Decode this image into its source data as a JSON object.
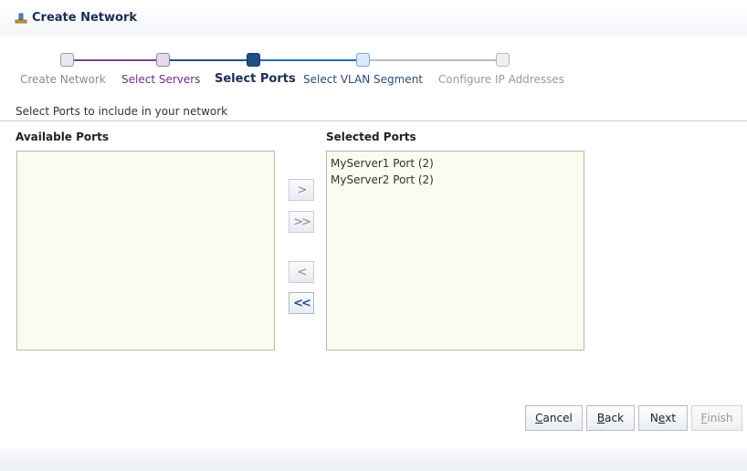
{
  "header": {
    "title": "Create Network",
    "icon": "network-icon"
  },
  "train": {
    "stops": [
      {
        "label": "Create Network",
        "state": "visited"
      },
      {
        "label": "Select Servers",
        "state": "done"
      },
      {
        "label": "Select Ports",
        "state": "current"
      },
      {
        "label": "Select VLAN Segment",
        "state": "next"
      },
      {
        "label": "Configure IP Addresses",
        "state": "disabled"
      }
    ]
  },
  "instructions": "Select Ports to include in your network",
  "available": {
    "header": "Available Ports",
    "items": []
  },
  "selected": {
    "header": "Selected Ports",
    "items": [
      "MyServer1 Port (2)",
      "MyServer2 Port (2)"
    ]
  },
  "shuttle": {
    "move": "move-right-icon",
    "move_all": "move-all-right-icon",
    "remove": "move-left-icon",
    "remove_all": "move-all-left-icon"
  },
  "footer": {
    "cancel_prefix": "",
    "cancel_mnemonic": "C",
    "cancel_rest": "ancel",
    "back_mnemonic": "B",
    "back_rest": "ack",
    "next_prefix": "N",
    "next_mnemonic": "e",
    "next_rest": "xt",
    "finish_mnemonic": "F",
    "finish_rest": "inish"
  },
  "colors": {
    "accent": "#1f4e86",
    "visited_step": "#6b2f86"
  }
}
